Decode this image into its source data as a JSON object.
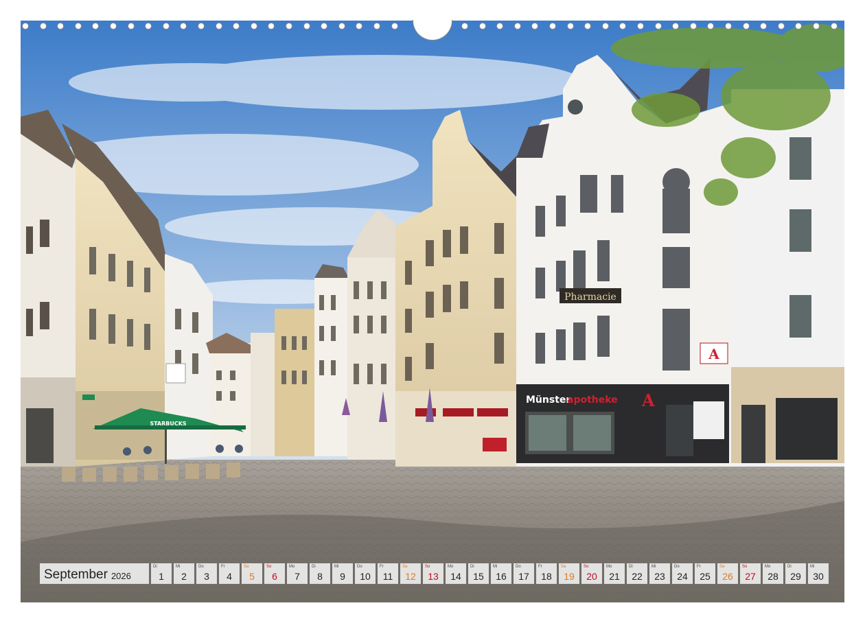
{
  "calendar": {
    "month": "September",
    "year": "2026",
    "days": [
      {
        "dow": "Di",
        "num": "1",
        "type": "weekday"
      },
      {
        "dow": "Mi",
        "num": "2",
        "type": "weekday"
      },
      {
        "dow": "Do",
        "num": "3",
        "type": "weekday"
      },
      {
        "dow": "Fr",
        "num": "4",
        "type": "weekday"
      },
      {
        "dow": "Sa",
        "num": "5",
        "type": "sat"
      },
      {
        "dow": "So",
        "num": "6",
        "type": "sun"
      },
      {
        "dow": "Mo",
        "num": "7",
        "type": "weekday"
      },
      {
        "dow": "Di",
        "num": "8",
        "type": "weekday"
      },
      {
        "dow": "Mi",
        "num": "9",
        "type": "weekday"
      },
      {
        "dow": "Do",
        "num": "10",
        "type": "weekday"
      },
      {
        "dow": "Fr",
        "num": "11",
        "type": "weekday"
      },
      {
        "dow": "Sa",
        "num": "12",
        "type": "sat"
      },
      {
        "dow": "So",
        "num": "13",
        "type": "sun"
      },
      {
        "dow": "Mo",
        "num": "14",
        "type": "weekday"
      },
      {
        "dow": "Di",
        "num": "15",
        "type": "weekday"
      },
      {
        "dow": "Mi",
        "num": "16",
        "type": "weekday"
      },
      {
        "dow": "Do",
        "num": "17",
        "type": "weekday"
      },
      {
        "dow": "Fr",
        "num": "18",
        "type": "weekday"
      },
      {
        "dow": "Sa",
        "num": "19",
        "type": "sat"
      },
      {
        "dow": "So",
        "num": "20",
        "type": "sun"
      },
      {
        "dow": "Mo",
        "num": "21",
        "type": "weekday"
      },
      {
        "dow": "Di",
        "num": "22",
        "type": "weekday"
      },
      {
        "dow": "Mi",
        "num": "23",
        "type": "weekday"
      },
      {
        "dow": "Do",
        "num": "24",
        "type": "weekday"
      },
      {
        "dow": "Fr",
        "num": "25",
        "type": "weekday"
      },
      {
        "dow": "Sa",
        "num": "26",
        "type": "sat"
      },
      {
        "dow": "So",
        "num": "27",
        "type": "sun"
      },
      {
        "dow": "Mo",
        "num": "28",
        "type": "weekday"
      },
      {
        "dow": "Di",
        "num": "29",
        "type": "weekday"
      },
      {
        "dow": "Mi",
        "num": "30",
        "type": "weekday"
      }
    ]
  },
  "photo": {
    "signs": {
      "starbucks": "STARBUCKS",
      "pharmacie": "Pharmacie",
      "muenster_plain": "Münster",
      "muenster_accent": "apotheke"
    }
  },
  "colors": {
    "saturday": "#e07822",
    "sunday": "#c00d1e",
    "sky_top": "#3d7cc9",
    "cobblestone": "#8f8a82",
    "starbucks_green": "#1f8a52",
    "apotheke_red": "#d0202e"
  }
}
